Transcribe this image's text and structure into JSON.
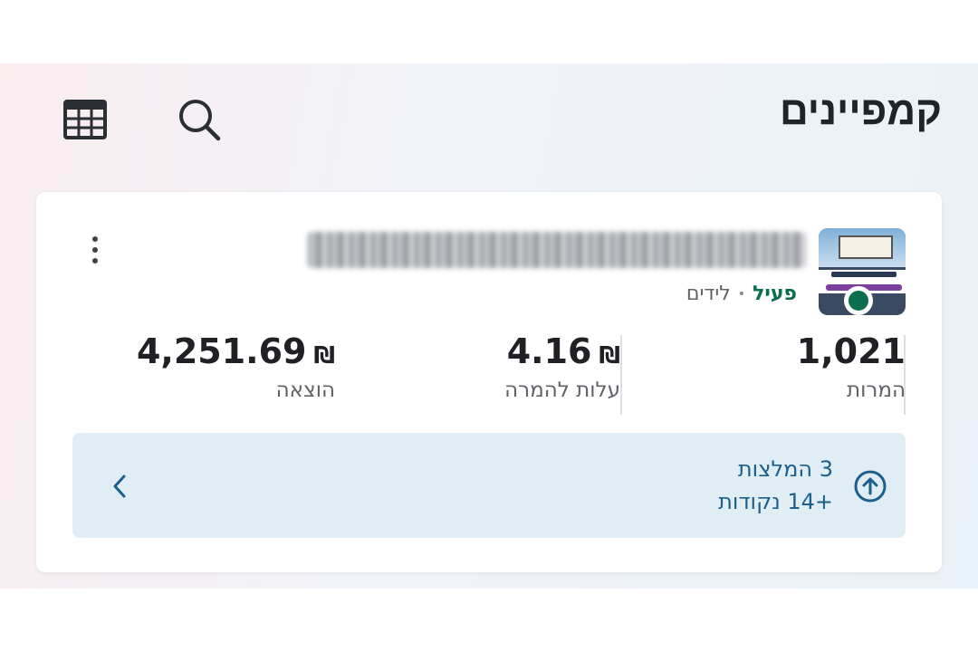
{
  "header": {
    "title": "קמפיינים",
    "table_icon": "table-icon",
    "search_icon": "search-icon"
  },
  "campaign": {
    "name": "████████████████████",
    "status": "פעיל",
    "separator": "•",
    "type": "לידים",
    "status_color": "#0b6e4f",
    "metrics": [
      {
        "label": "המרות",
        "value": "1,021",
        "currency": ""
      },
      {
        "label": "עלות להמרה",
        "value": "4.16",
        "currency": "₪"
      },
      {
        "label": "הוצאה",
        "value": "4,251.69",
        "currency": "₪"
      }
    ],
    "recommendations": {
      "line1": "3 המלצות",
      "line2": "+14 נקודות",
      "icon": "arrow-up-circle-icon",
      "chevron": "chevron-left-icon",
      "color": "#1c5f8c",
      "background": "#e1edf5"
    }
  }
}
